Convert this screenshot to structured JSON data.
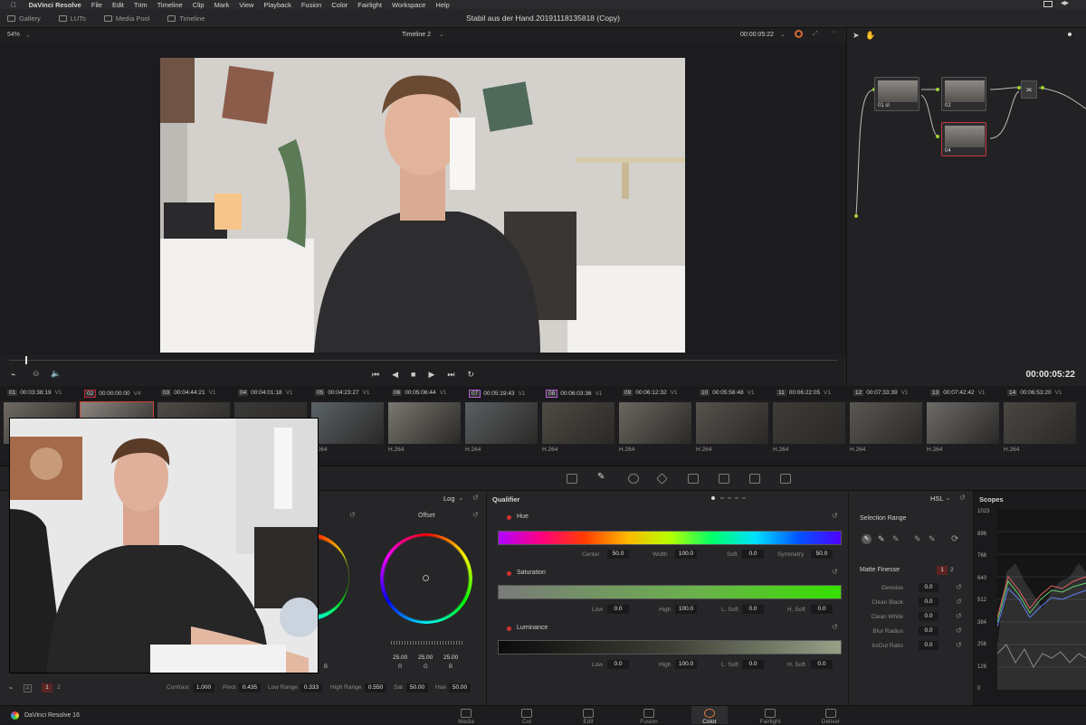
{
  "menubar": {
    "app": "DaVinci Resolve",
    "items": [
      "File",
      "Edit",
      "Trim",
      "Timeline",
      "Clip",
      "Mark",
      "View",
      "Playback",
      "Fusion",
      "Color",
      "Fairlight",
      "Workspace",
      "Help"
    ]
  },
  "toolbar": {
    "buttons": [
      "Gallery",
      "LUTs",
      "Media Pool",
      "Timeline"
    ],
    "project_title": "Stabil aus der Hand.20191118135818 (Copy)"
  },
  "viewer": {
    "zoom": "54%",
    "timeline_name": "Timeline 2",
    "timecode_top": "00:00:05:22",
    "timecode": "00:00:05:22",
    "playhead_fraction": 0.02
  },
  "nodes": [
    {
      "label": "01",
      "sub": "sl"
    },
    {
      "label": "02",
      "sub": ""
    },
    {
      "label": "04",
      "sub": ""
    }
  ],
  "clips": [
    {
      "num": "01",
      "tc": "00:03:38:19",
      "track": "V1",
      "codec": ""
    },
    {
      "num": "02",
      "tc": "00:00:00:00",
      "track": "V4",
      "codec": "",
      "selected": true
    },
    {
      "num": "03",
      "tc": "00:04:44:21",
      "track": "V1",
      "codec": ""
    },
    {
      "num": "04",
      "tc": "00:04:01:18",
      "track": "V1",
      "codec": ""
    },
    {
      "num": "05",
      "tc": "00:04:23:27",
      "track": "V1",
      "codec": "H.264"
    },
    {
      "num": "06",
      "tc": "00:05:06:44",
      "track": "V1",
      "codec": "H.264"
    },
    {
      "num": "07",
      "tc": "00:05:19:43",
      "track": "V1",
      "codec": "H.264"
    },
    {
      "num": "08",
      "tc": "00:06:03:36",
      "track": "V1",
      "codec": "H.264"
    },
    {
      "num": "09",
      "tc": "00:06:12:32",
      "track": "V1",
      "codec": "H.264"
    },
    {
      "num": "10",
      "tc": "00:05:56:48",
      "track": "V1",
      "codec": "H.264"
    },
    {
      "num": "11",
      "tc": "00:06:22:05",
      "track": "V1",
      "codec": "H.264"
    },
    {
      "num": "12",
      "tc": "00:07:33:39",
      "track": "V1",
      "codec": "H.264"
    },
    {
      "num": "13",
      "tc": "00:07:42:42",
      "track": "V1",
      "codec": "H.264"
    },
    {
      "num": "14",
      "tc": "00:06:53:20",
      "track": "V1",
      "codec": "H.264"
    }
  ],
  "wheels": {
    "mode": "Log",
    "offset_label": "Offset",
    "offset_values": [
      "25.00",
      "25.00",
      "25.00"
    ],
    "offset_channels": [
      "R",
      "G",
      "B"
    ],
    "partial_channel": "B"
  },
  "adjustments": {
    "page_a": "1",
    "page_b": "2",
    "contrast_label": "Contrast",
    "contrast": "1.000",
    "pivot_label": "Pivot",
    "pivot": "0.435",
    "lowrange_label": "Low Range",
    "lowrange": "0.333",
    "highrange_label": "High Range",
    "highrange": "0.550",
    "sat_label": "Sat",
    "sat": "50.00",
    "hue_label": "Hue",
    "hue": "50.00"
  },
  "qualifier": {
    "title": "Qualifier",
    "mode": "HSL",
    "hue": {
      "label": "Hue",
      "center_label": "Center",
      "center": "50.0",
      "width_label": "Width",
      "width": "100.0",
      "soft_label": "Soft",
      "soft": "0.0",
      "sym_label": "Symmetry",
      "sym": "50.0"
    },
    "saturation": {
      "label": "Saturation",
      "low_label": "Low",
      "low": "0.0",
      "high_label": "High",
      "high": "100.0",
      "lsoft_label": "L. Soft",
      "lsoft": "0.0",
      "hsoft_label": "H. Soft",
      "hsoft": "0.0"
    },
    "luminance": {
      "label": "Luminance",
      "low_label": "Low",
      "low": "0.0",
      "high_label": "High",
      "high": "100.0",
      "lsoft_label": "L. Soft",
      "lsoft": "0.0",
      "hsoft_label": "H. Soft",
      "hsoft": "0.0"
    }
  },
  "selection": {
    "title": "Selection Range",
    "matte_title": "Matte Finesse",
    "page_a": "1",
    "page_b": "2",
    "rows": [
      {
        "label": "Denoise",
        "value": "0.0"
      },
      {
        "label": "Clean Black",
        "value": "0.0"
      },
      {
        "label": "Clean White",
        "value": "0.0"
      },
      {
        "label": "Blur Radius",
        "value": "0.0"
      },
      {
        "label": "In/Out Ratio",
        "value": "0.0"
      }
    ]
  },
  "scopes": {
    "title": "Scopes",
    "ticks": [
      "1023",
      "896",
      "768",
      "640",
      "512",
      "384",
      "256",
      "128",
      "0"
    ]
  },
  "bottombar": {
    "app_version": "DaVinci Resolve 16",
    "pages": [
      "Media",
      "Cut",
      "Edit",
      "Fusion",
      "Color",
      "Fairlight",
      "Deliver"
    ],
    "active_page": "Color"
  }
}
